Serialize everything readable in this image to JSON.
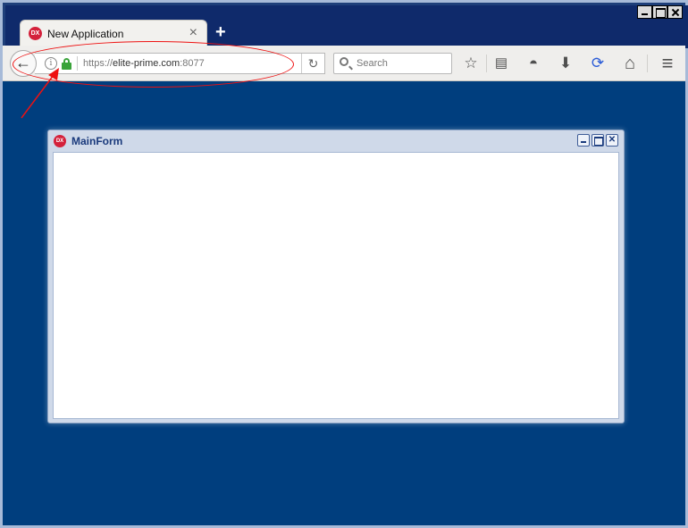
{
  "browser": {
    "tab": {
      "title": "New Application",
      "favicon": "DX"
    },
    "new_tab_label": "+",
    "url": {
      "scheme": "https://",
      "host": "elite-prime.com",
      "port": ":8077"
    },
    "search_placeholder": "Search",
    "tab_close": "×",
    "back_glyph": "←",
    "reload_glyph": "↻",
    "toolbar_glyphs": {
      "bookmark": "☆",
      "reader": "▤",
      "pocket": "◓",
      "download": "⬇",
      "sync": "⟳",
      "home": "⌂",
      "menu": "≡"
    }
  },
  "mainform": {
    "title": "MainForm",
    "icon": "DX",
    "close_glyph": "✕"
  },
  "annotation": {
    "color": "#ee1111"
  }
}
